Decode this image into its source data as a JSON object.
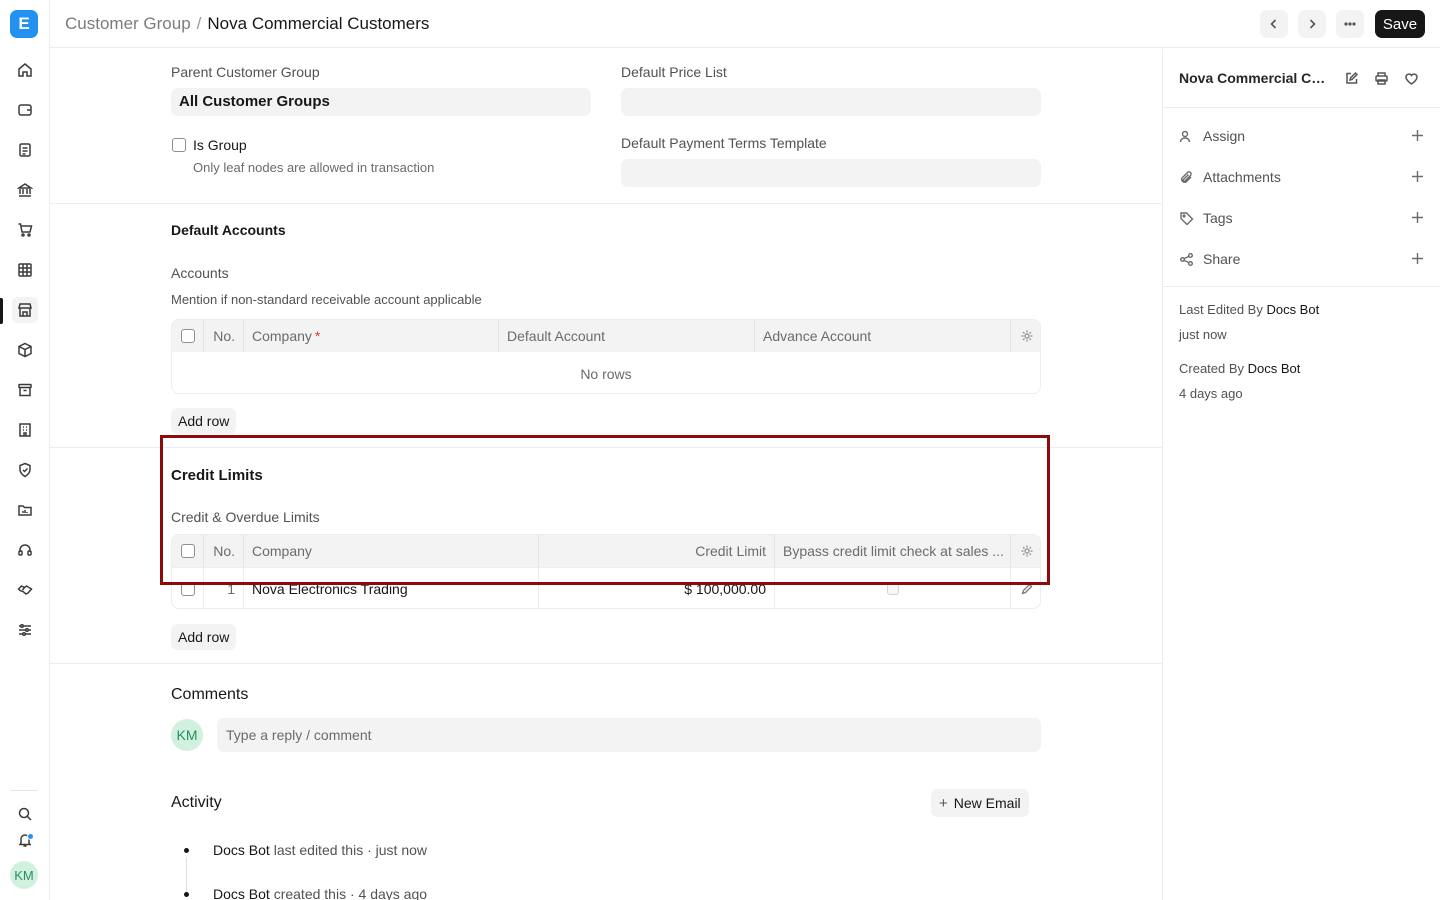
{
  "app": {
    "logo_letter": "E"
  },
  "breadcrumb": {
    "parent": "Customer Group",
    "separator": "/",
    "current": "Nova Commercial Customers"
  },
  "toolbar": {
    "save_label": "Save"
  },
  "form": {
    "parent_group_label": "Parent Customer Group",
    "parent_group_value": "All Customer Groups",
    "default_price_list_label": "Default Price List",
    "default_price_list_value": "",
    "payment_terms_label": "Default Payment Terms Template",
    "payment_terms_value": "",
    "is_group_label": "Is Group",
    "is_group_checked": false,
    "is_group_hint": "Only leaf nodes are allowed in transaction"
  },
  "accounts_section": {
    "title": "Default Accounts",
    "table_label": "Accounts",
    "table_hint": "Mention if non-standard receivable account applicable",
    "columns": [
      "No.",
      "Company",
      "Default Account",
      "Advance Account"
    ],
    "empty_text": "No rows",
    "add_row_label": "Add row"
  },
  "credit_section": {
    "title": "Credit Limits",
    "table_label": "Credit & Overdue Limits",
    "columns": [
      "No.",
      "Company",
      "Credit Limit",
      "Bypass credit limit check at sales ..."
    ],
    "rows": [
      {
        "no": "1",
        "company": "Nova Electronics Trading",
        "credit_limit": "$ 100,000.00",
        "bypass": false
      }
    ],
    "add_row_label": "Add row"
  },
  "comments": {
    "title": "Comments",
    "avatar_initials": "KM",
    "placeholder": "Type a reply / comment"
  },
  "activity": {
    "title": "Activity",
    "new_email_label": "New Email",
    "items": [
      {
        "who": "Docs Bot",
        "text": " last edited this · just now"
      },
      {
        "who": "Docs Bot",
        "text": " created this · 4 days ago"
      }
    ]
  },
  "right_sidebar": {
    "title": "Nova Commercial Customers",
    "actions": [
      "Assign",
      "Attachments",
      "Tags",
      "Share"
    ],
    "last_edited_prefix": "Last Edited By ",
    "last_edited_by": "Docs Bot",
    "last_edited_when": "just now",
    "created_prefix": "Created By ",
    "created_by": "Docs Bot",
    "created_when": "4 days ago"
  },
  "user": {
    "initials": "KM"
  },
  "colors": {
    "primary_dark": "#171717",
    "logo_blue": "#2490ef",
    "highlight": "#8b0a0a",
    "avatar_bg": "#d1f1de",
    "avatar_fg": "#278f5e"
  },
  "icons": {
    "sidebar": [
      "home-icon",
      "wallet-icon",
      "invoice-icon",
      "bank-icon",
      "cart-icon",
      "table-icon",
      "store-icon",
      "package-icon",
      "archive-icon",
      "building-icon",
      "shield-icon",
      "folder-chart-icon",
      "headset-icon",
      "handshake-icon",
      "sliders-icon"
    ]
  }
}
